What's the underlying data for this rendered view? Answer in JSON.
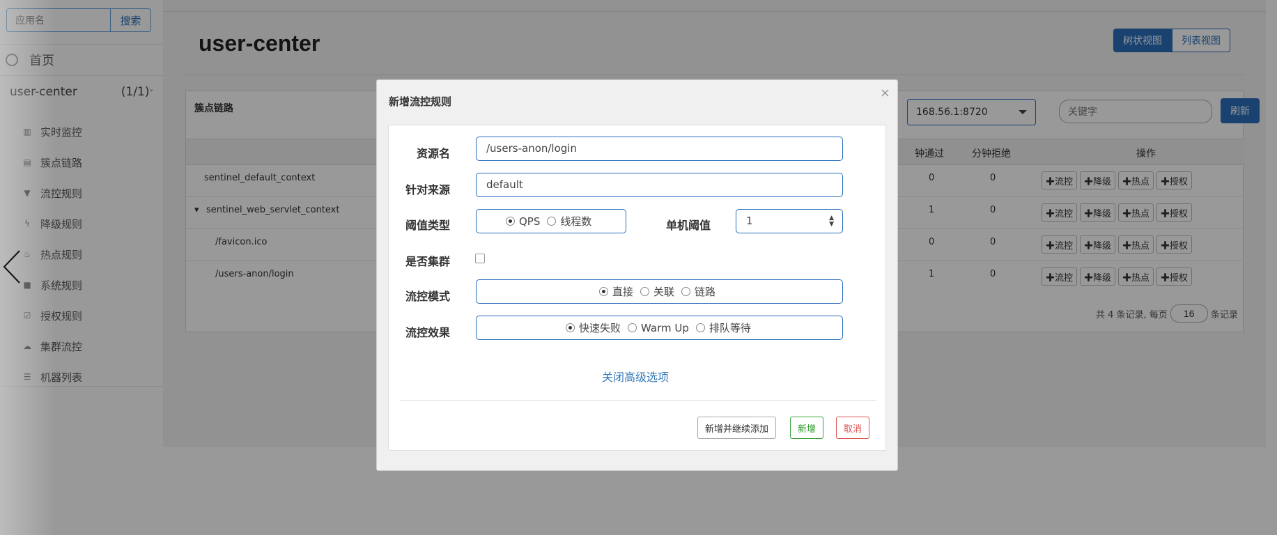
{
  "sidebar": {
    "search_placeholder": "应用名",
    "search_button": "搜索",
    "home": "首页",
    "app_name": "user-center",
    "app_count": "(1/1)",
    "menu": [
      "实时监控",
      "簇点链路",
      "流控规则",
      "降级规则",
      "热点规则",
      "系统规则",
      "授权规则",
      "集群流控",
      "机器列表"
    ]
  },
  "main": {
    "title": "user-center",
    "tree_view": "树状视图",
    "list_view": "列表视图",
    "panel_title": "簇点链路",
    "machine": "168.56.1:8720",
    "keyword_placeholder": "关键字",
    "refresh": "刷新",
    "columns": {
      "pass": "钟通过",
      "block": "分钟拒绝",
      "ops": "操作"
    },
    "rows": [
      {
        "name": "sentinel_default_context",
        "pass": "0",
        "block": "0"
      },
      {
        "name": "sentinel_web_servlet_context",
        "pass": "1",
        "block": "0"
      },
      {
        "name": "/favicon.ico",
        "pass": "0",
        "block": "0"
      },
      {
        "name": "/users-anon/login",
        "pass": "1",
        "block": "0"
      }
    ],
    "op_labels": [
      "✚流控",
      "✚降级",
      "✚热点",
      "✚授权"
    ],
    "pager": {
      "prefix": "共 4 条记录, 每页",
      "page_size": "16",
      "suffix": "条记录"
    }
  },
  "modal": {
    "title": "新增流控规则",
    "close": "×",
    "resource_label": "资源名",
    "resource_value": "/users-anon/login",
    "origin_label": "针对来源",
    "origin_value": "default",
    "threshold_type_label": "阈值类型",
    "threshold_type_options": [
      "QPS",
      "线程数"
    ],
    "threshold_type_selected": "QPS",
    "single_threshold_label": "单机阈值",
    "single_threshold_value": "1",
    "cluster_label": "是否集群",
    "mode_label": "流控模式",
    "mode_options": [
      "直接",
      "关联",
      "链路"
    ],
    "mode_selected": "直接",
    "effect_label": "流控效果",
    "effect_options": [
      "快速失败",
      "Warm Up",
      "排队等待"
    ],
    "effect_selected": "快速失败",
    "advanced_link": "关闭高级选项",
    "btn_add_continue": "新增并继续添加",
    "btn_add": "新增",
    "btn_cancel": "取消"
  }
}
